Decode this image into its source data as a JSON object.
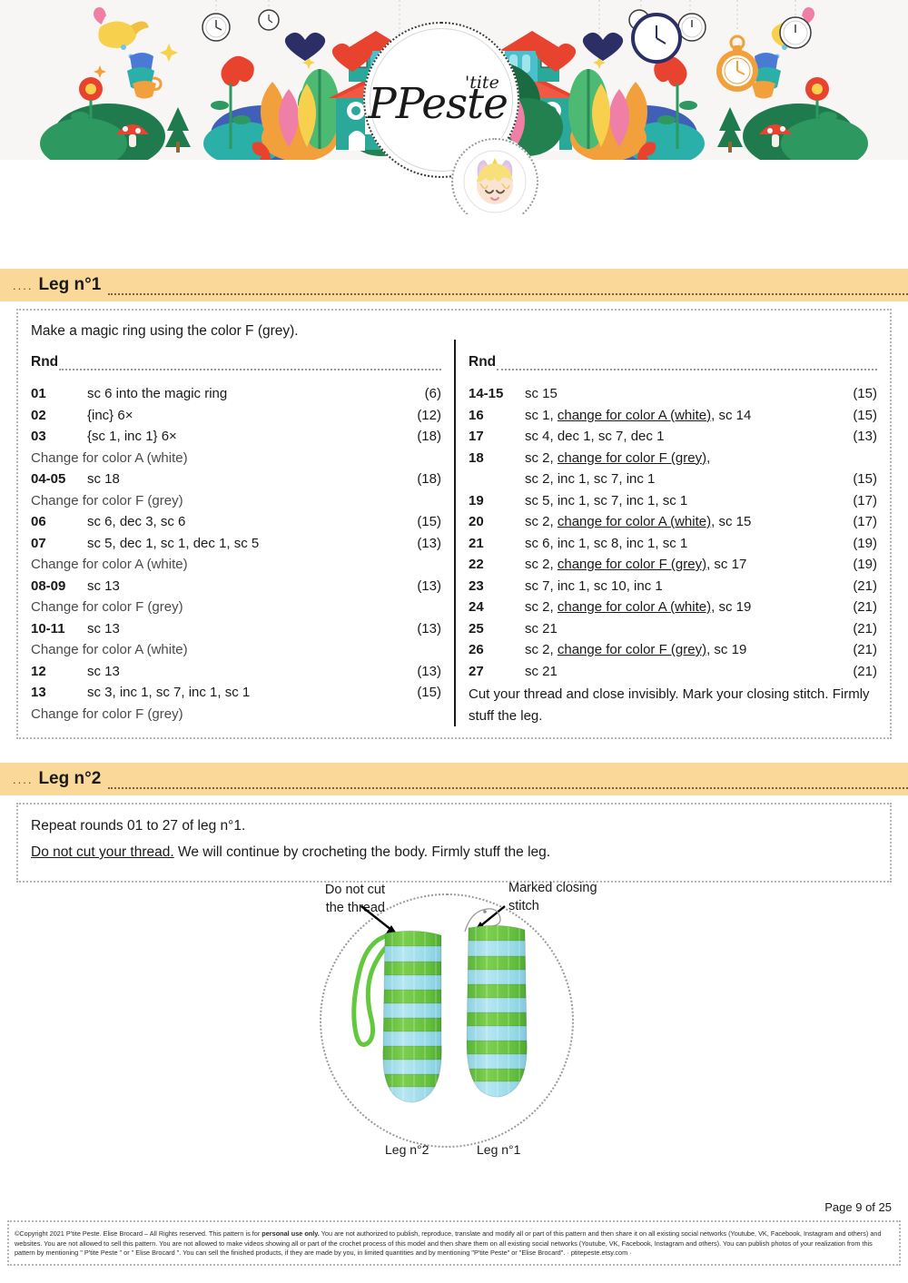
{
  "header": {
    "logo_main": "Peste",
    "logo_initial": "P",
    "logo_sup": "'tite",
    "brand_full": "P'tite Peste",
    "avatar_name": "unicorn-girl-avatar"
  },
  "sections": [
    {
      "id": "leg1",
      "lead": "....",
      "title": "Leg n°1"
    },
    {
      "id": "leg2",
      "lead": "....",
      "title": "Leg n°2"
    }
  ],
  "leg1": {
    "intro": "Make a magic ring using the color F (grey).",
    "rnd_label": "Rnd",
    "left_rows": [
      {
        "type": "rnd",
        "num": "01",
        "txt": "sc 6 into the magic ring",
        "cnt": "(6)"
      },
      {
        "type": "rnd",
        "num": "02",
        "txt": "{inc} 6×",
        "cnt": "(12)"
      },
      {
        "type": "rnd",
        "num": "03",
        "txt": "{sc 1, inc 1} 6×",
        "cnt": "(18)"
      },
      {
        "type": "note",
        "txt": "Change for color A (white)"
      },
      {
        "type": "rnd",
        "num": "04-05",
        "txt": "sc 18",
        "cnt": "(18)"
      },
      {
        "type": "note",
        "txt": "Change for color F (grey)"
      },
      {
        "type": "rnd",
        "num": "06",
        "txt": "sc 6, dec 3, sc 6",
        "cnt": "(15)"
      },
      {
        "type": "rnd",
        "num": "07",
        "txt": "sc 5, dec 1, sc 1, dec 1, sc 5",
        "cnt": "(13)"
      },
      {
        "type": "note",
        "txt": "Change for color A (white)"
      },
      {
        "type": "rnd",
        "num": "08-09",
        "txt": "sc 13",
        "cnt": "(13)"
      },
      {
        "type": "note",
        "txt": "Change for color F (grey)"
      },
      {
        "type": "rnd",
        "num": "10-11",
        "txt": "sc 13",
        "cnt": "(13)"
      },
      {
        "type": "note",
        "txt": "Change for color A (white)"
      },
      {
        "type": "rnd",
        "num": "12",
        "txt": "sc 13",
        "cnt": "(13)"
      },
      {
        "type": "rnd",
        "num": "13",
        "txt": "sc 3, inc 1, sc 7, inc 1, sc 1",
        "cnt": "(15)"
      },
      {
        "type": "note",
        "txt": "Change for color F (grey)"
      }
    ],
    "right_rows": [
      {
        "type": "rnd",
        "num": "14-15",
        "txt": "sc 15",
        "cnt": "(15)"
      },
      {
        "type": "rnd_u",
        "num": "16",
        "pre": "sc 1, ",
        "u": "change for color A (white)",
        "post": ", sc 14",
        "cnt": "(15)"
      },
      {
        "type": "rnd",
        "num": "17",
        "txt": "sc 4, dec 1, sc 7, dec 1",
        "cnt": "(13)"
      },
      {
        "type": "rnd_u",
        "num": "18",
        "pre": "sc 2, ",
        "u": "change for color F (grey)",
        "post": ",",
        "cnt": ""
      },
      {
        "type": "cont",
        "num": "",
        "txt": "sc 2, inc 1, sc 7, inc 1",
        "cnt": "(15)"
      },
      {
        "type": "rnd",
        "num": "19",
        "txt": "sc 5, inc 1, sc 7, inc 1, sc 1",
        "cnt": "(17)"
      },
      {
        "type": "rnd_u",
        "num": "20",
        "pre": "sc 2, ",
        "u": "change for color A (white)",
        "post": ", sc 15",
        "cnt": "(17)"
      },
      {
        "type": "rnd",
        "num": "21",
        "txt": "sc 6, inc 1, sc 8, inc 1, sc 1",
        "cnt": "(19)"
      },
      {
        "type": "rnd_u",
        "num": "22",
        "pre": "sc 2, ",
        "u": "change for color F (grey)",
        "post": ", sc 17",
        "cnt": "(19)"
      },
      {
        "type": "rnd",
        "num": "23",
        "txt": "sc 7, inc 1, sc 10, inc 1",
        "cnt": "(21)"
      },
      {
        "type": "rnd_u",
        "num": "24",
        "pre": "sc 2, ",
        "u": "change for color A (white)",
        "post": ", sc 19",
        "cnt": "(21)"
      },
      {
        "type": "rnd",
        "num": "25",
        "txt": "sc 21",
        "cnt": "(21)"
      },
      {
        "type": "rnd_u",
        "num": "26",
        "pre": "sc 2, ",
        "u": "change for color F (grey)",
        "post": ", sc 19",
        "cnt": "(21)"
      },
      {
        "type": "rnd",
        "num": "27",
        "txt": "sc 21",
        "cnt": "(21)"
      }
    ],
    "closing": "Cut your thread and close invisibly. Mark your closing stitch. Firmly stuff the leg."
  },
  "leg2": {
    "line1": "Repeat rounds 01 to 27 of leg n°1.",
    "line2_underlined": "Do not cut your thread.",
    "line2_rest": " We will continue by crocheting the body. Firmly stuff the leg."
  },
  "photo": {
    "annotation_left": "Do not cut the thread",
    "annotation_right": "Marked closing stitch",
    "caption_left": "Leg n°2",
    "caption_right": "Leg n°1",
    "yarn_green": "#6cc04a",
    "yarn_blue": "#9fdbe8"
  },
  "footer": {
    "page": "Page 9 of 25",
    "copyright_a": "©Copyright 2021 P'tite Peste. Elise Brocard – All Rights reserved. This pattern is for ",
    "copyright_bold": "personal use only.",
    "copyright_b": " You are not authorized to publish, reproduce, translate and modify all or part of this pattern and then share it on all existing social networks (Youtube, VK, Facebook, Instagram and others) and websites. You are not allowed to sell this pattern. You are not allowed to make videos showing all or part of the crochet process of this model and then share them on all existing social networks (Youtube, VK, Facebook, Instagram and others). You can publish photos of your realization from this pattern by mentioning \" P'tite Peste \" or \" Elise Brocard \". You can sell the finished products, if they are made by you, in limited quantities and by mentioning \"P'tite Peste\" or \"Elise Brocard\".  · ptitepeste.etsy.com ·"
  },
  "colors": {
    "band": "#fad89a",
    "border_dotted": "#b5b5b5",
    "note_text": "#4a4a4a"
  }
}
